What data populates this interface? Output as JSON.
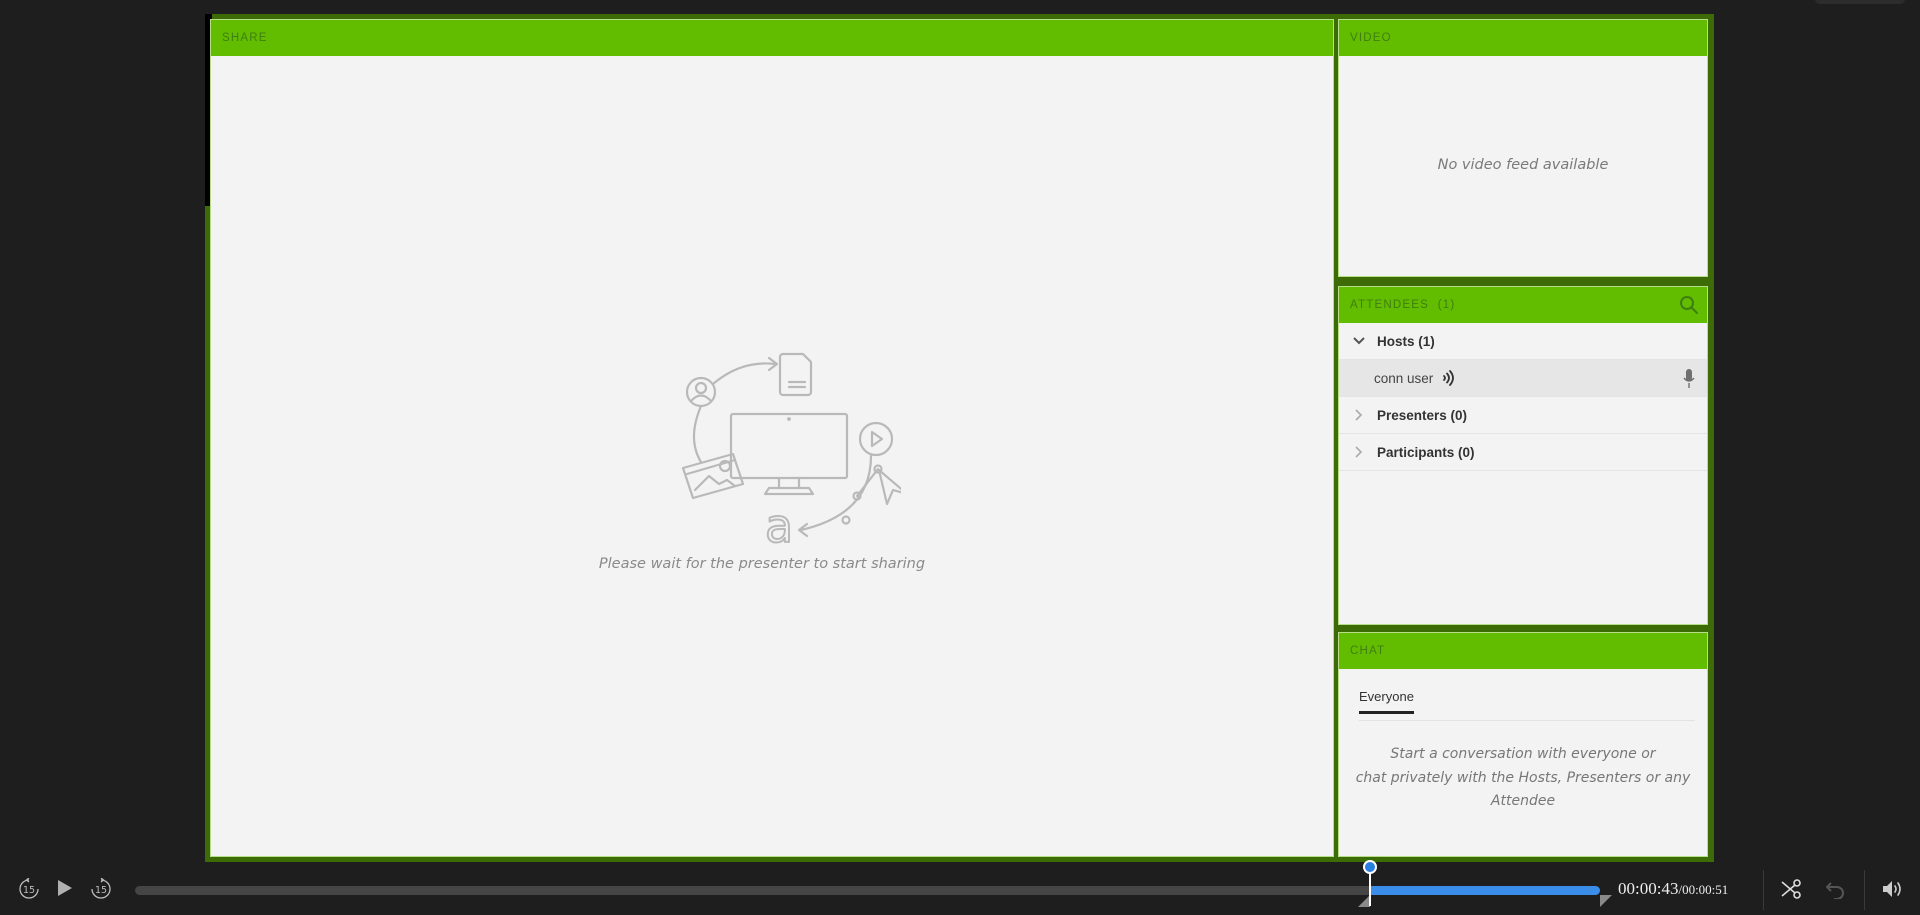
{
  "pods": {
    "share": {
      "title": "SHARE",
      "message": "Please wait for the presenter to start sharing"
    },
    "video": {
      "title": "VIDEO",
      "message": "No video feed available"
    },
    "attendees": {
      "title": "ATTENDEES  (1)",
      "count": 1,
      "search_icon": "search-icon",
      "groups": [
        {
          "label": "Hosts (1)",
          "expanded": true,
          "members": [
            {
              "name": "conn user",
              "speaking": true,
              "mic": true
            }
          ]
        },
        {
          "label": "Presenters (0)",
          "expanded": false,
          "members": []
        },
        {
          "label": "Participants (0)",
          "expanded": false,
          "members": []
        }
      ]
    },
    "chat": {
      "title": "CHAT",
      "tabs": [
        {
          "label": "Everyone",
          "active": true
        }
      ],
      "empty_line1": "Start a conversation with everyone or",
      "empty_line2": "chat privately with the Hosts, Presenters or any",
      "empty_line3": "Attendee"
    }
  },
  "player": {
    "skip_back_label": "15",
    "skip_forward_label": "15",
    "current_time": "00:00:43",
    "total_time": "/00:00:51",
    "progress_fraction": 0.843,
    "trim_start_fraction": 0.843,
    "trim_end_fraction": 1.0,
    "buttons": [
      "skip-back-15",
      "play",
      "skip-forward-15",
      "cut",
      "undo",
      "volume"
    ]
  },
  "colors": {
    "pod_header": "#62bd00",
    "stage_border": "#3d6b05",
    "progress": "#3a8eea",
    "background": "#1e1e1e"
  }
}
